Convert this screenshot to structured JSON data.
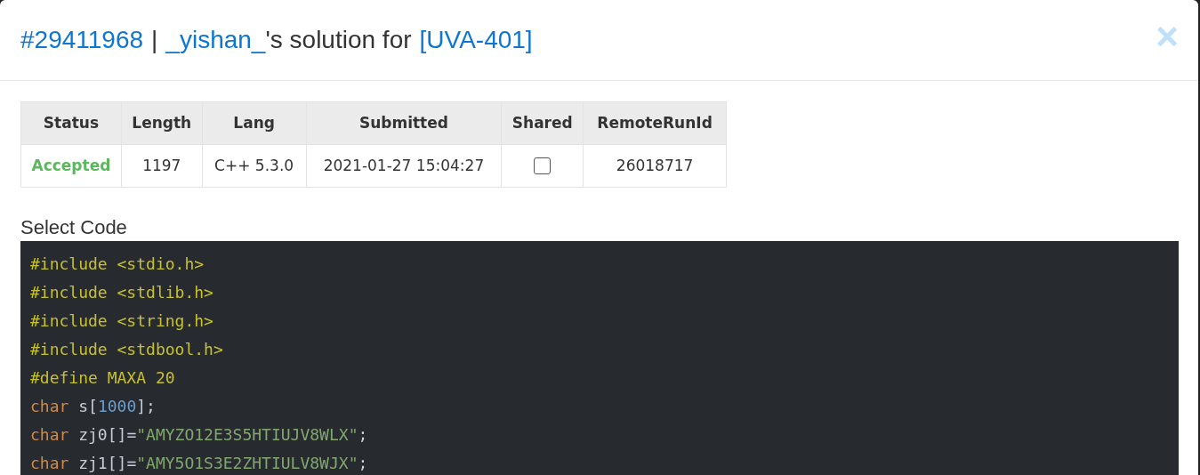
{
  "modal": {
    "title": {
      "run_id": "#29411968",
      "separator": "|",
      "user": "_yishan_",
      "middle": "'s solution for",
      "problem": "[UVA-401]"
    },
    "close": "×"
  },
  "table": {
    "columns": [
      "Status",
      "Length",
      "Lang",
      "Submitted",
      "Shared",
      "RemoteRunId"
    ],
    "rows": [
      {
        "status": "Accepted",
        "length": "1197",
        "lang": "C++ 5.3.0",
        "submitted": "2021-01-27 15:04:27",
        "shared": {
          "checked": false
        },
        "remote_run_id": "26018717"
      }
    ]
  },
  "code_section": {
    "label": "Select Code",
    "lines": [
      [
        {
          "kind": "meta",
          "text": "#include <stdio.h>"
        }
      ],
      [
        {
          "kind": "meta",
          "text": "#include <stdlib.h>"
        }
      ],
      [
        {
          "kind": "meta",
          "text": "#include <string.h>"
        }
      ],
      [
        {
          "kind": "meta",
          "text": "#include <stdbool.h>"
        }
      ],
      [
        {
          "kind": "meta",
          "text": "#define MAXA 20"
        }
      ],
      [
        {
          "kind": "keyword",
          "text": "char"
        },
        {
          "kind": "plain",
          "text": " s["
        },
        {
          "kind": "number",
          "text": "1000"
        },
        {
          "kind": "plain",
          "text": "];"
        }
      ],
      [
        {
          "kind": "keyword",
          "text": "char"
        },
        {
          "kind": "plain",
          "text": " zj0[]="
        },
        {
          "kind": "string",
          "text": "\"AMYZO12E3S5HTIUJV8WLX\""
        },
        {
          "kind": "plain",
          "text": ";"
        }
      ],
      [
        {
          "kind": "keyword",
          "text": "char"
        },
        {
          "kind": "plain",
          "text": " zj1[]="
        },
        {
          "kind": "string",
          "text": "\"AMY5O1S3E2ZHTIULV8WJX\""
        },
        {
          "kind": "plain",
          "text": ";"
        }
      ]
    ]
  }
}
